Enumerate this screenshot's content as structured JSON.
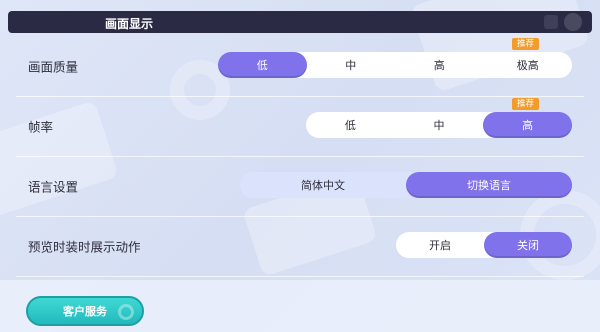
{
  "header": {
    "title": "画面显示"
  },
  "settings": {
    "quality": {
      "label": "画面质量",
      "options": [
        "低",
        "中",
        "高",
        "极高"
      ],
      "selected": "低",
      "badge": "推荐"
    },
    "framerate": {
      "label": "帧率",
      "options": [
        "低",
        "中",
        "高"
      ],
      "selected": "高",
      "badge": "推荐"
    },
    "language": {
      "label": "语言设置",
      "current": "简体中文",
      "switch_label": "切换语言"
    },
    "preview_action": {
      "label": "预览时装时展示动作",
      "options": [
        "开启",
        "关闭"
      ],
      "selected": "关闭"
    }
  },
  "footer": {
    "service_label": "客户服务"
  },
  "colors": {
    "accent": "#7f72ea",
    "badge": "#f29c2b",
    "header_bg": "#2a2a44",
    "service_btn": "#2cc8c8"
  }
}
